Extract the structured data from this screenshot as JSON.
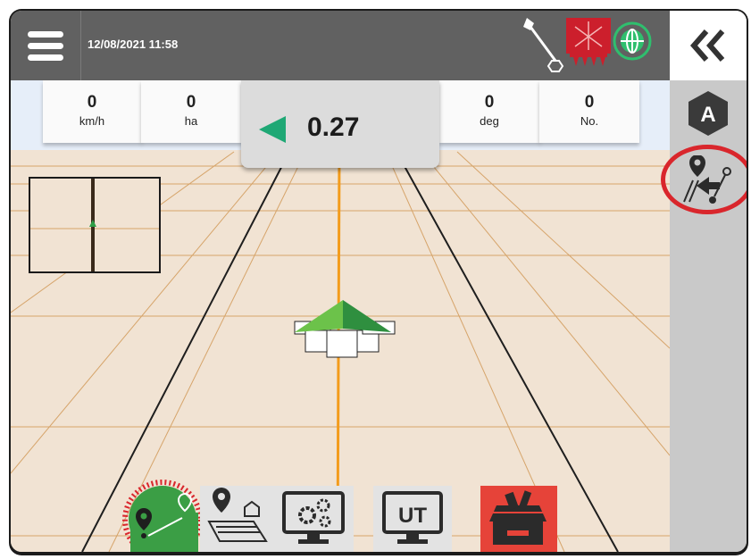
{
  "header": {
    "datetime": "12/08/2021 11:58",
    "icons": [
      "menu-icon",
      "gps-antenna-icon",
      "boom-sections-icon",
      "globe-icon"
    ]
  },
  "sidebar": {
    "collapse_icon": "double-chevron-left-icon",
    "auto_steer_label": "A",
    "next_path_icon": "next-path-icon"
  },
  "info_bar": {
    "cells": [
      {
        "value": "0",
        "unit": "km/h"
      },
      {
        "value": "0",
        "unit": "ha"
      },
      {
        "value": "0",
        "unit": "deg"
      },
      {
        "value": "0",
        "unit": "No."
      }
    ],
    "cross_track": {
      "value": "0.27",
      "direction": "left"
    }
  },
  "bottom_bar": {
    "buttons": [
      {
        "name": "guidance",
        "icon": "guidance-line-icon"
      },
      {
        "name": "job",
        "icon": "job-field-icon"
      },
      {
        "name": "configuration",
        "icon": "monitor-gears-icon"
      },
      {
        "name": "ut",
        "label": "UT"
      },
      {
        "name": "tools",
        "icon": "toolbox-icon"
      }
    ]
  },
  "colors": {
    "topbar": "#616161",
    "map_bg": "#f1e3d3",
    "accent_green": "#1fa875",
    "guidance_line": "#f39c1c",
    "highlight_red": "#d9262c",
    "tools_red": "#e64339"
  }
}
